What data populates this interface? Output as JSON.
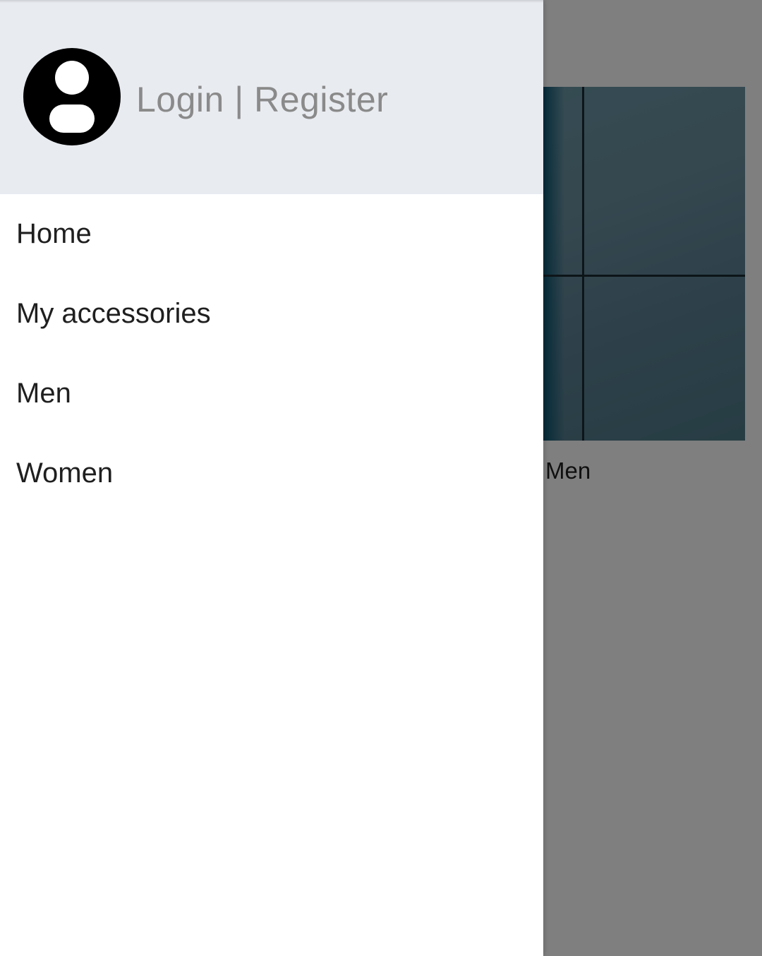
{
  "drawer": {
    "auth_link": "Login | Register",
    "avatar_icon": "account-circle-icon",
    "items": [
      {
        "label": "Home"
      },
      {
        "label": "My accessories"
      },
      {
        "label": "Men"
      },
      {
        "label": "Women"
      }
    ]
  },
  "background": {
    "card_label": "Men"
  },
  "colors": {
    "header_bg": "#e8ebf0",
    "auth_text": "#8a8a8a",
    "menu_text": "#1f1f1f",
    "scrim": "rgba(0,0,0,0.5)"
  }
}
